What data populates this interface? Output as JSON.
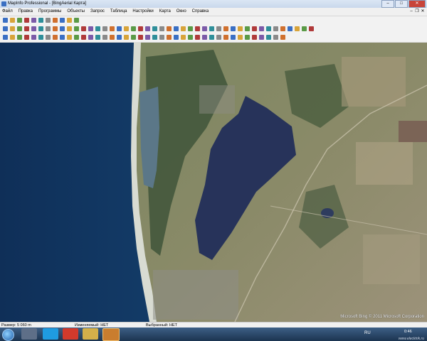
{
  "window": {
    "title": "MapInfo Professional - [BingAerial Карта]"
  },
  "menubar": {
    "items": [
      "Файл",
      "Правка",
      "Программы",
      "Объекты",
      "Запрос",
      "Таблица",
      "Настройки",
      "Карта",
      "Окно",
      "Справка"
    ]
  },
  "map": {
    "copyright": "Microsoft Bing © 2011 Microsoft Corporation"
  },
  "status": {
    "scale": "Размер: 5 060 m",
    "editable": "Изменяемый: НЕТ",
    "selected": "Выбранный: НЕТ"
  },
  "taskbar": {
    "lang": "RU",
    "time": "0:46"
  },
  "watermark": "www.elecktrik.ru",
  "colors": {
    "sea_deep": "#123a66",
    "sea_shallow": "#4e8fb0",
    "beach": "#d7d9cf",
    "land": "#6e7c57",
    "forest": "#3d5238",
    "lake": "#27335a"
  }
}
